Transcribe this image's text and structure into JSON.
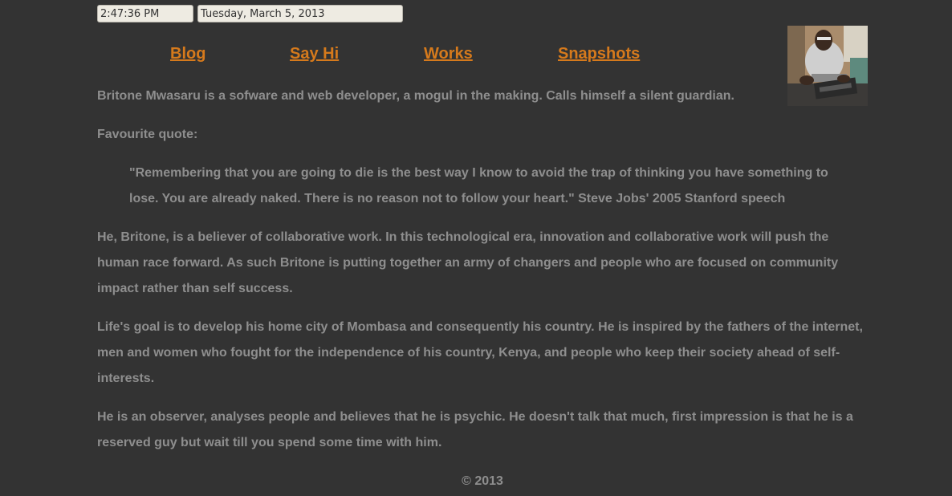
{
  "clock": {
    "time": "2:47:36 PM",
    "date": "Tuesday, March 5, 2013"
  },
  "nav": {
    "blog": "Blog",
    "say_hi": "Say Hi",
    "works": "Works",
    "snapshots": "Snapshots"
  },
  "colors": {
    "background": "#333333",
    "text": "#8e8e8e",
    "link": "#d67a1c"
  },
  "content": {
    "intro": "Britone Mwasaru is a sofware and web developer, a mogul in the making. Calls himself a silent guardian.",
    "quote_label": "Favourite quote:",
    "quote": "\"Remembering that you are going to die is the best way I know to avoid the trap of thinking you have something to lose. You are already naked. There is no reason not to follow your heart.\" Steve Jobs' 2005 Stanford speech",
    "collab": "He, Britone, is a believer of collaborative work. In this technological era, innovation and collaborative work will push the human race forward. As such Britone is putting together an army of changers and people who are focused on community impact rather than self success.",
    "goal": "Life's goal is to develop his home city of Mombasa and consequently his country. He is inspired by the fathers of the internet, men and women who fought for the independence of his country, Kenya, and people who keep their society ahead of self-interests.",
    "observer": "He is an observer, analyses people and believes that he is psychic. He doesn't talk that much, first impression is that he is a reserved guy but wait till you spend some time with him."
  },
  "footer": {
    "copyright": "© 2013"
  }
}
